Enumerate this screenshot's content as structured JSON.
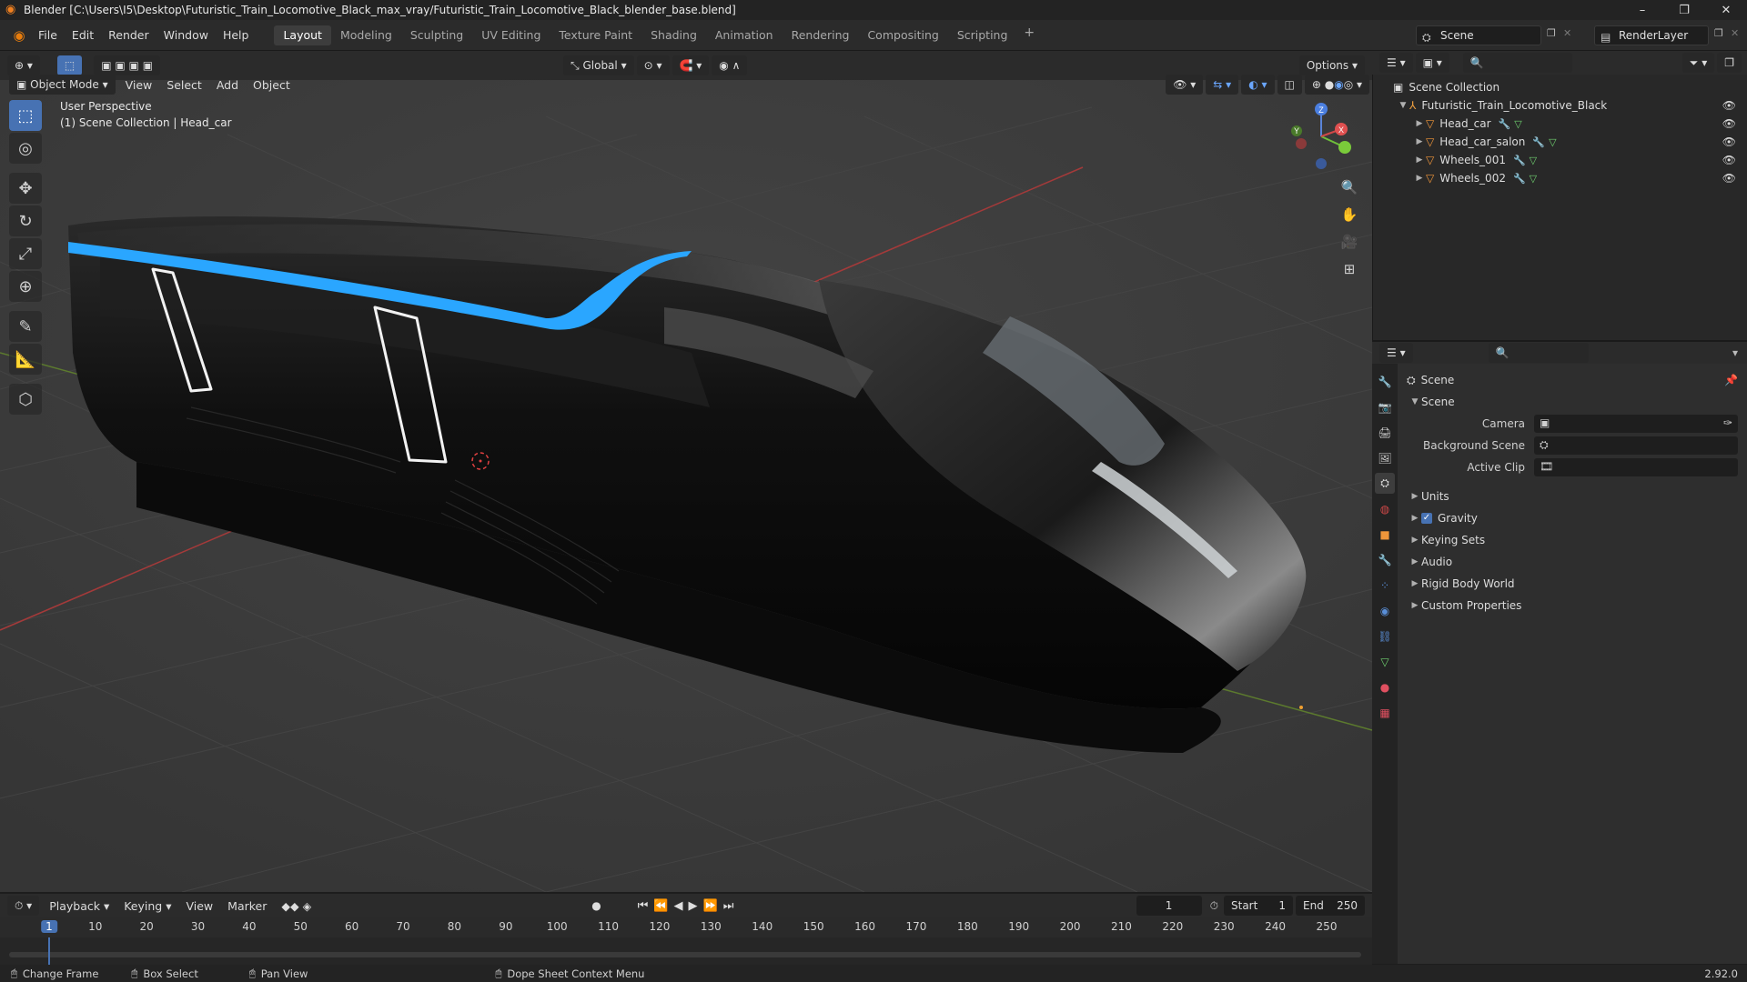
{
  "window": {
    "title": "Blender [C:\\Users\\I5\\Desktop\\Futuristic_Train_Locomotive_Black_max_vray/Futuristic_Train_Locomotive_Black_blender_base.blend]",
    "minimize": "–",
    "maximize": "❐",
    "close": "✕"
  },
  "menu": {
    "items": [
      "File",
      "Edit",
      "Render",
      "Window",
      "Help"
    ]
  },
  "workspaces": {
    "tabs": [
      "Layout",
      "Modeling",
      "Sculpting",
      "UV Editing",
      "Texture Paint",
      "Shading",
      "Animation",
      "Rendering",
      "Compositing",
      "Scripting"
    ],
    "active": "Layout",
    "add": "+"
  },
  "scene_selector": {
    "value": "Scene"
  },
  "renderlayer_selector": {
    "value": "RenderLayer"
  },
  "viewport_header": {
    "mode": "Object Mode",
    "menus": [
      "View",
      "Select",
      "Add",
      "Object"
    ],
    "transform_orientation": "Global",
    "options": "Options"
  },
  "viewport": {
    "overlay_line1": "User Perspective",
    "overlay_line2": "(1) Scene Collection | Head_car",
    "gizmo_labels": {
      "x": "X",
      "y": "Y",
      "z": "Z"
    }
  },
  "outliner": {
    "root": "Scene Collection",
    "collection": "Futuristic_Train_Locomotive_Black",
    "objects": [
      "Head_car",
      "Head_car_salon",
      "Wheels_001",
      "Wheels_002"
    ]
  },
  "properties": {
    "context_title": "Scene",
    "panel_title": "Scene",
    "fields": [
      {
        "label": "Camera",
        "value": ""
      },
      {
        "label": "Background Scene",
        "value": ""
      },
      {
        "label": "Active Clip",
        "value": ""
      }
    ],
    "sections": [
      {
        "label": "Units",
        "checkbox": false
      },
      {
        "label": "Gravity",
        "checkbox": true
      },
      {
        "label": "Keying Sets",
        "checkbox": false
      },
      {
        "label": "Audio",
        "checkbox": false
      },
      {
        "label": "Rigid Body World",
        "checkbox": false
      },
      {
        "label": "Custom Properties",
        "checkbox": false
      }
    ]
  },
  "timeline": {
    "menus": [
      "Playback",
      "Keying",
      "View",
      "Marker"
    ],
    "current_frame": "1",
    "start_label": "Start",
    "start": "1",
    "end_label": "End",
    "end": "250",
    "ticks": [
      "1",
      "10",
      "20",
      "30",
      "40",
      "50",
      "60",
      "70",
      "80",
      "90",
      "100",
      "110",
      "120",
      "130",
      "140",
      "150",
      "160",
      "170",
      "180",
      "190",
      "200",
      "210",
      "220",
      "230",
      "240",
      "250"
    ]
  },
  "statusbar": {
    "change_frame": "Change Frame",
    "box_select": "Box Select",
    "pan_view": "Pan View",
    "context_menu": "Dope Sheet Context Menu",
    "version": "2.92.0"
  },
  "colors": {
    "accent": "#4772b3",
    "train_stripe": "#2aa6ff",
    "object_icon": "#f0963a"
  }
}
